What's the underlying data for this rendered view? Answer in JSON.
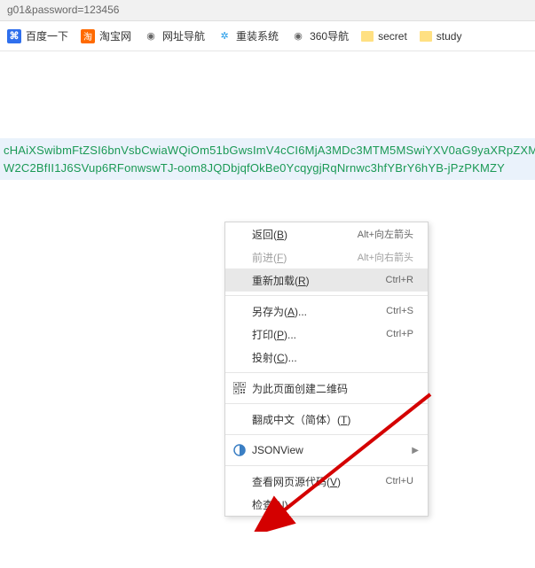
{
  "url_fragment": "g01&password=123456",
  "bookmarks": [
    {
      "label": "百度一下",
      "icon": "baidu"
    },
    {
      "label": "淘宝网",
      "icon": "taobao"
    },
    {
      "label": "网址导航",
      "icon": "globe"
    },
    {
      "label": "重装系统",
      "icon": "chong"
    },
    {
      "label": "360导航",
      "icon": "globe"
    },
    {
      "label": "secret",
      "icon": "folder"
    },
    {
      "label": "study",
      "icon": "folder"
    }
  ],
  "json_response": {
    "line1": "cHAiXSwibmFtZSI6bnVsbCwiaWQiOm51bGwsImV4cCI6MjA3MDc3MTM5MSwiYXV0aG9yaXRpZXM",
    "line2": "W2C2BfII1J6SVup6RFonwswTJ-oom8JQDbjqfOkBe0YcqygjRqNrnwc3hfYBrY6hYB-jPzPKMZY"
  },
  "context_menu": {
    "items": [
      {
        "label": "返回(B)",
        "shortcut": "Alt+向左箭头",
        "accel": "B"
      },
      {
        "label": "前进(F)",
        "shortcut": "Alt+向右箭头",
        "accel": "F",
        "disabled": true
      },
      {
        "label": "重新加载(R)",
        "shortcut": "Ctrl+R",
        "accel": "R",
        "highlighted": true
      },
      {
        "sep": true
      },
      {
        "label": "另存为(A)...",
        "shortcut": "Ctrl+S",
        "accel": "A"
      },
      {
        "label": "打印(P)...",
        "shortcut": "Ctrl+P",
        "accel": "P"
      },
      {
        "label": "投射(C)...",
        "accel": "C"
      },
      {
        "sep": true
      },
      {
        "label": "为此页面创建二维码",
        "icon": "qr"
      },
      {
        "sep": true
      },
      {
        "label": "翻成中文（简体）(T)",
        "accel": "T"
      },
      {
        "sep": true
      },
      {
        "label": "JSONView",
        "icon": "jsonview",
        "submenu": true
      },
      {
        "sep": true
      },
      {
        "label": "查看网页源代码(V)",
        "shortcut": "Ctrl+U",
        "accel": "V"
      },
      {
        "label": "检查(N)",
        "accel": "N"
      }
    ]
  }
}
